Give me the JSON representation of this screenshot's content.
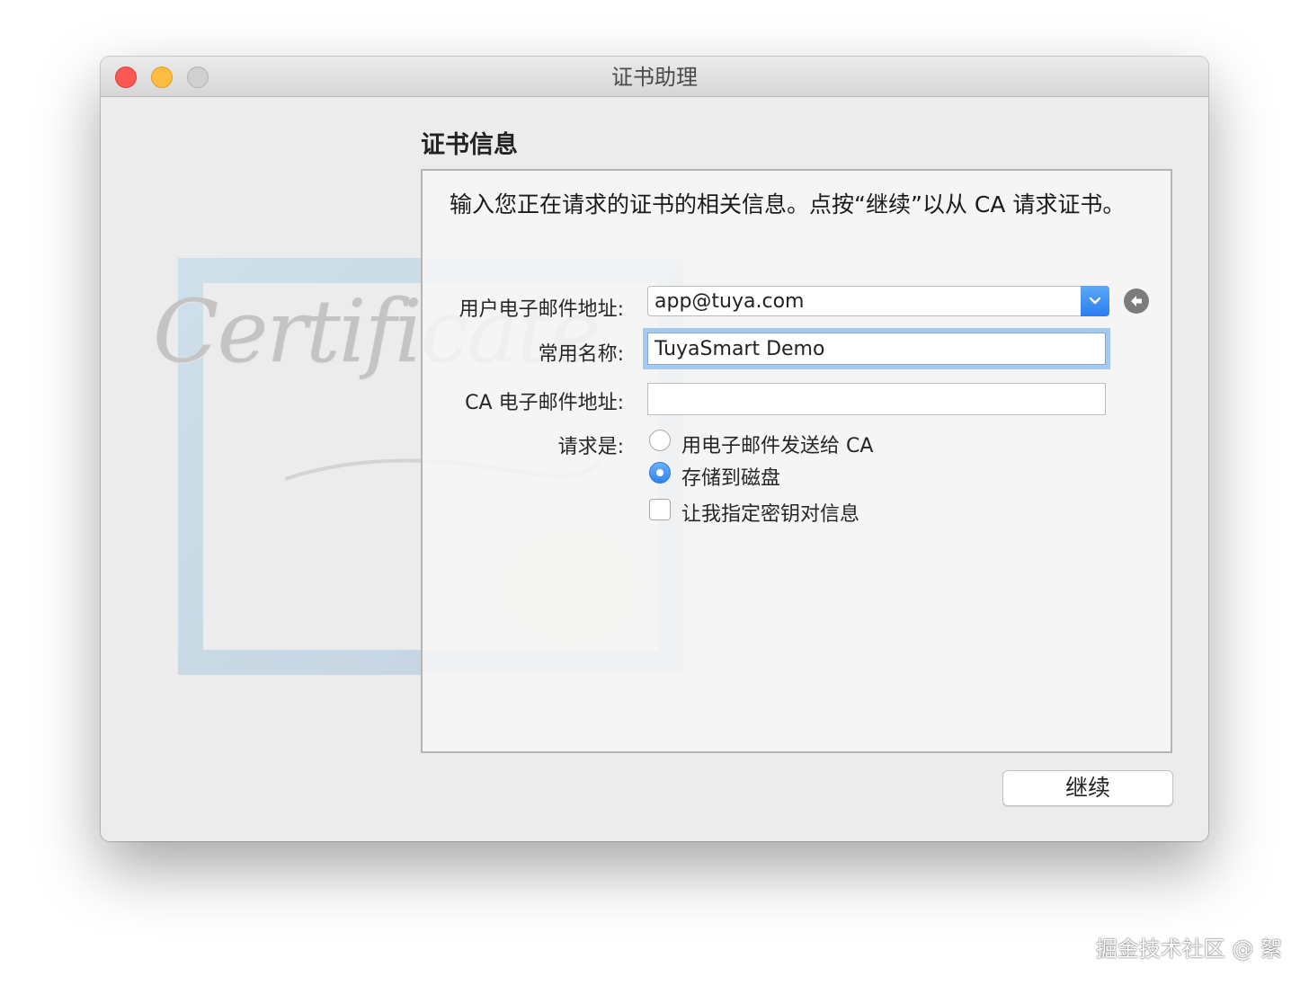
{
  "window": {
    "title": "证书助理"
  },
  "watermark_art": {
    "word": "Certificate"
  },
  "section": {
    "title": "证书信息",
    "intro": "输入您正在请求的证书的相关信息。点按“继续”以从 CA 请求证书。"
  },
  "form": {
    "email_label": "用户电子邮件地址:",
    "email_value": "app@tuya.com",
    "common_name_label": "常用名称:",
    "common_name_value": "TuyaSmart Demo",
    "ca_email_label": "CA 电子邮件地址:",
    "ca_email_value": "",
    "request_label": "请求是:",
    "options": [
      {
        "label": "用电子邮件发送给 CA",
        "selected": false
      },
      {
        "label": "存储到磁盘",
        "selected": true
      }
    ],
    "checkbox_label": "让我指定密钥对信息",
    "checkbox_checked": false
  },
  "buttons": {
    "continue": "继续"
  },
  "footer": {
    "watermark": "掘金技术社区 @ 絮"
  },
  "colors": {
    "accent": "#2f83f2",
    "focus_ring": "#a7c8ef",
    "close": "#fc5753",
    "minimize": "#fdbc40",
    "maximize": "#d0d0d0"
  }
}
